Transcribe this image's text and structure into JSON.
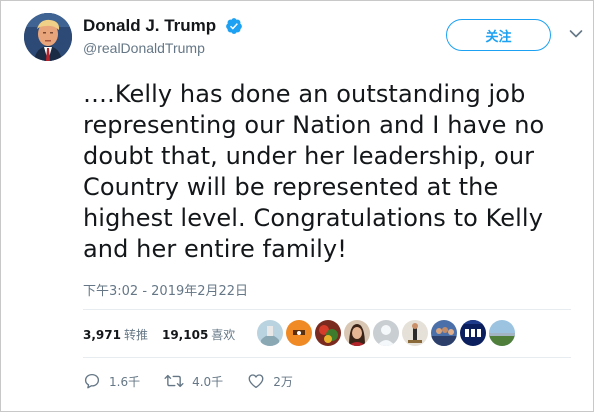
{
  "user": {
    "display_name": "Donald J. Trump",
    "handle": "@realDonaldTrump",
    "verified_icon": "verified-badge-icon"
  },
  "follow_button": {
    "label": "关注"
  },
  "tweet": {
    "text": "….Kelly has done an outstanding job representing our Nation and I have no doubt that, under her leadership, our Country will be represented at the highest level. Congratulations to Kelly and her entire family!",
    "timestamp": "下午3:02 - 2019年2月22日"
  },
  "stats": {
    "retweets_count": "3,971",
    "retweets_label": "转推",
    "likes_count": "19,105",
    "likes_label": "喜欢"
  },
  "likers": [
    "avatar-1",
    "avatar-2",
    "avatar-3",
    "avatar-4",
    "avatar-5",
    "avatar-6",
    "avatar-7",
    "avatar-8",
    "avatar-9",
    "avatar-10"
  ],
  "actions": {
    "reply_count": "1.6千",
    "retweet_count": "4.0千",
    "like_count": "2万"
  },
  "colors": {
    "accent": "#1da1f2",
    "muted": "#657786",
    "text": "#14171a"
  }
}
